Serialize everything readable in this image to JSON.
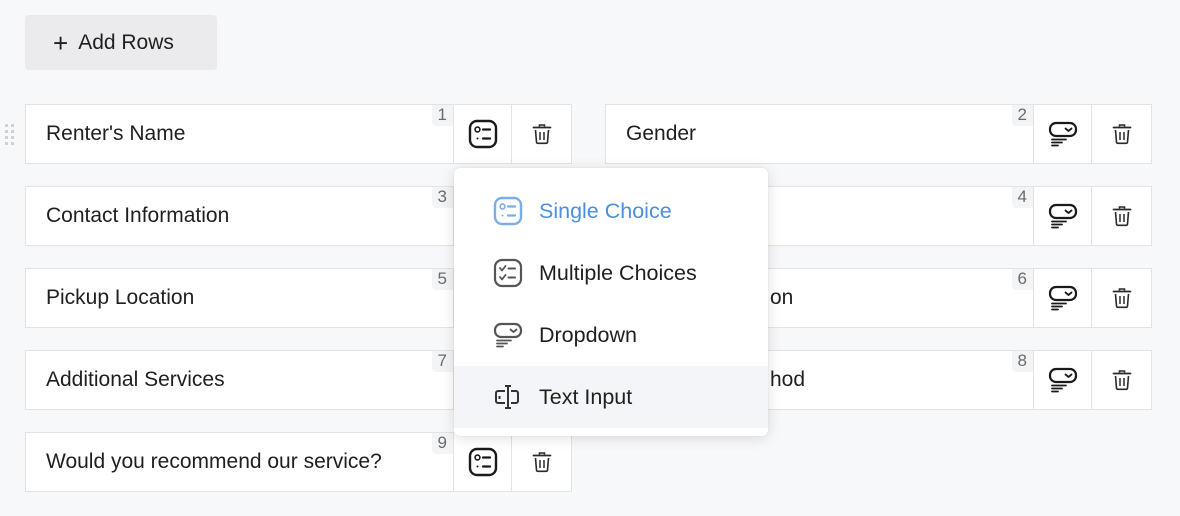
{
  "toolbar": {
    "add_rows_icon": "plus-icon",
    "add_rows_label": "Add Rows"
  },
  "rows": [
    {
      "index": "1",
      "label": "Renter's Name",
      "type": "single-choice",
      "type_icon": "single-choice-icon",
      "delete_icon": "trash-icon"
    },
    {
      "index": "2",
      "label": "Gender",
      "type": "dropdown",
      "type_icon": "dropdown-icon",
      "delete_icon": "trash-icon"
    },
    {
      "index": "3",
      "label": "Contact Information",
      "type": "",
      "type_icon": "",
      "delete_icon": ""
    },
    {
      "index": "4",
      "label": "",
      "type": "dropdown",
      "type_icon": "dropdown-icon",
      "delete_icon": "trash-icon"
    },
    {
      "index": "5",
      "label": "Pickup Location",
      "type": "",
      "type_icon": "",
      "delete_icon": ""
    },
    {
      "index": "6",
      "label": "on",
      "type": "dropdown",
      "type_icon": "dropdown-icon",
      "delete_icon": "trash-icon"
    },
    {
      "index": "7",
      "label": "Additional Services",
      "type": "",
      "type_icon": "",
      "delete_icon": ""
    },
    {
      "index": "8",
      "label": "hod",
      "type": "dropdown",
      "type_icon": "dropdown-icon",
      "delete_icon": "trash-icon"
    },
    {
      "index": "9",
      "label": "Would you recommend our service?",
      "type": "single-choice",
      "type_icon": "single-choice-icon",
      "delete_icon": "trash-icon"
    }
  ],
  "type_menu": {
    "items": [
      {
        "label": "Single Choice",
        "icon": "single-choice-icon",
        "state": "selected"
      },
      {
        "label": "Multiple Choices",
        "icon": "multiple-choice-icon",
        "state": "default"
      },
      {
        "label": "Dropdown",
        "icon": "dropdown-icon",
        "state": "default"
      },
      {
        "label": "Text Input",
        "icon": "text-input-icon",
        "state": "hovered"
      }
    ]
  },
  "colors": {
    "accent": "#4a8fe0",
    "background": "#f7f8fa",
    "button_bg": "#ebebed",
    "border": "#e2e3e6",
    "hover_bg": "#f4f5f8"
  }
}
